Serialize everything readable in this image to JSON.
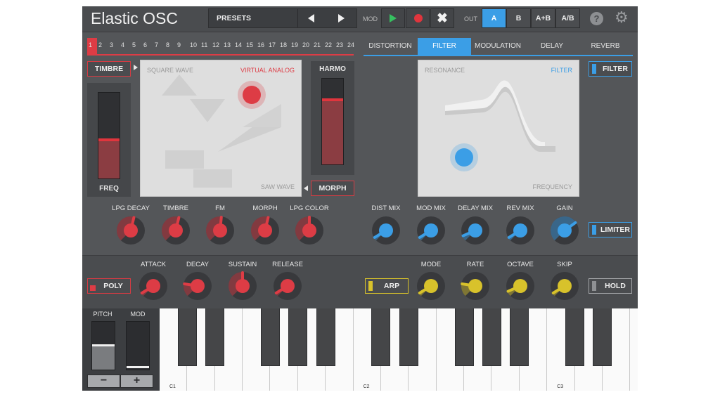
{
  "header": {
    "title": "Elastic OSC",
    "presets_label": "PRESETS",
    "mod_label": "MOD",
    "out_label": "OUT",
    "out_options": [
      "A",
      "B",
      "A+B",
      "A/B"
    ],
    "out_selected": "A"
  },
  "steps": [
    "1",
    "2",
    "3",
    "4",
    "5",
    "6",
    "7",
    "8",
    "9",
    "10",
    "11",
    "12",
    "13",
    "14",
    "15",
    "16",
    "17",
    "18",
    "19",
    "20",
    "21",
    "22",
    "23",
    "24"
  ],
  "active_step": "1",
  "tabs": [
    "DISTORTION",
    "FILTER",
    "MODULATION",
    "DELAY",
    "REVERB"
  ],
  "active_tab": "FILTER",
  "osc": {
    "timbre_button": "TIMBRE",
    "freq_label": "FREQ",
    "freq_level": 0.47,
    "harmo_label": "HARMO",
    "harmo_level": 0.77,
    "morph_button": "MORPH",
    "pad_top_left": "SQUARE WAVE",
    "pad_top_right": "VIRTUAL ANALOG",
    "pad_bottom_right": "SAW WAVE"
  },
  "filter_pad": {
    "top_left": "RESONANCE",
    "top_right": "FILTER",
    "bottom_right": "FREQUENCY",
    "filter_button": "FILTER",
    "limiter_button": "LIMITER"
  },
  "knobs_red": [
    {
      "label": "LPG DECAY",
      "value": 0.55
    },
    {
      "label": "TIMBRE",
      "value": 0.55
    },
    {
      "label": "FM",
      "value": 0.52
    },
    {
      "label": "MORPH",
      "value": 0.55
    },
    {
      "label": "LPG COLOR",
      "value": 0.5
    }
  ],
  "knobs_blue": [
    {
      "label": "DIST MIX",
      "value": 0.05
    },
    {
      "label": "MOD MIX",
      "value": 0.05
    },
    {
      "label": "DELAY MIX",
      "value": 0.08
    },
    {
      "label": "REV MIX",
      "value": 0.05
    },
    {
      "label": "GAIN",
      "value": 0.7
    }
  ],
  "adsr": {
    "poly_button": "POLY",
    "knobs": [
      {
        "label": "ATTACK",
        "value": 0.05
      },
      {
        "label": "DECAY",
        "value": 0.2
      },
      {
        "label": "SUSTAIN",
        "value": 0.5
      },
      {
        "label": "RELEASE",
        "value": 0.05
      }
    ]
  },
  "arp": {
    "arp_button": "ARP",
    "hold_button": "HOLD",
    "knobs": [
      {
        "label": "MODE",
        "value": 0.05
      },
      {
        "label": "RATE",
        "value": 0.2
      },
      {
        "label": "OCTAVE",
        "value": 0.08
      },
      {
        "label": "SKIP",
        "value": 0.05
      }
    ]
  },
  "keyboard": {
    "pitch_label": "PITCH",
    "mod_label": "MOD",
    "minus": "−",
    "plus": "+",
    "octave_labels": [
      "C1",
      "C2",
      "C3"
    ]
  },
  "colors": {
    "red": "#dd3c45",
    "blue": "#3b9ee6",
    "yellow": "#d8c22b",
    "panel": "#545659"
  }
}
